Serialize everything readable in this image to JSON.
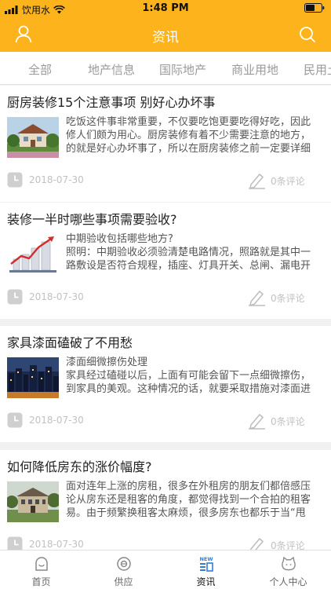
{
  "status_bar": {
    "carrier": "饮用水",
    "time": "1:48 PM"
  },
  "header": {
    "title": "资讯",
    "background_color": "#fcb31c"
  },
  "category_tabs": [
    "全部",
    "地产信息",
    "国际地产",
    "商业用地",
    "民用土"
  ],
  "articles": [
    {
      "title": "厨房装修15个注意事项 别好心办坏事",
      "summary_lines": [
        "吃饭这件事非常重要，不仅要吃饱更要吃得好吃，因此",
        "修人们颇为用心。厨房装修有着不少需要注意的地方，",
        "的就是好心办坏事了，所以在厨房装修之前一定要详细"
      ],
      "date": "2018-07-30",
      "comments": "0条评论"
    },
    {
      "title": "装修一半时哪些事项需要验收?",
      "summary_lines": [
        "中期验收包括哪些地方?",
        "照明：中期验收必须验清楚电路情况，照路就是其中一",
        "路敷设是否符合规程，插座、灯具开关、总闸、漏电开"
      ],
      "date": "2018-07-30",
      "comments": "0条评论"
    },
    {
      "title": "家具漆面磕破了不用愁",
      "summary_lines": [
        "漆面细微擦伤处理",
        "家具经过磕碰以后，上面有可能会留下一点细微擦伤，",
        "到家具的美观。这种情况的话，就要采取措施对漆面进"
      ],
      "date": "2018-07-30",
      "comments": "0条评论"
    },
    {
      "title": "如何降低房东的涨价幅度?",
      "summary_lines": [
        "面对连年上涨的房租，很多在外租房的朋友们都倍感压",
        "论从房东还是租客的角度，都觉得找到一个合拍的租客",
        "易。由于频繁换租客太麻烦，很多房东也都乐于当“甩"
      ],
      "date": "2018-07-30",
      "comments": "0条评论"
    }
  ],
  "tab_bar": {
    "items": [
      "首页",
      "供应",
      "资讯",
      "个人中心"
    ],
    "active_index": 2,
    "new_badge": "NEW"
  }
}
